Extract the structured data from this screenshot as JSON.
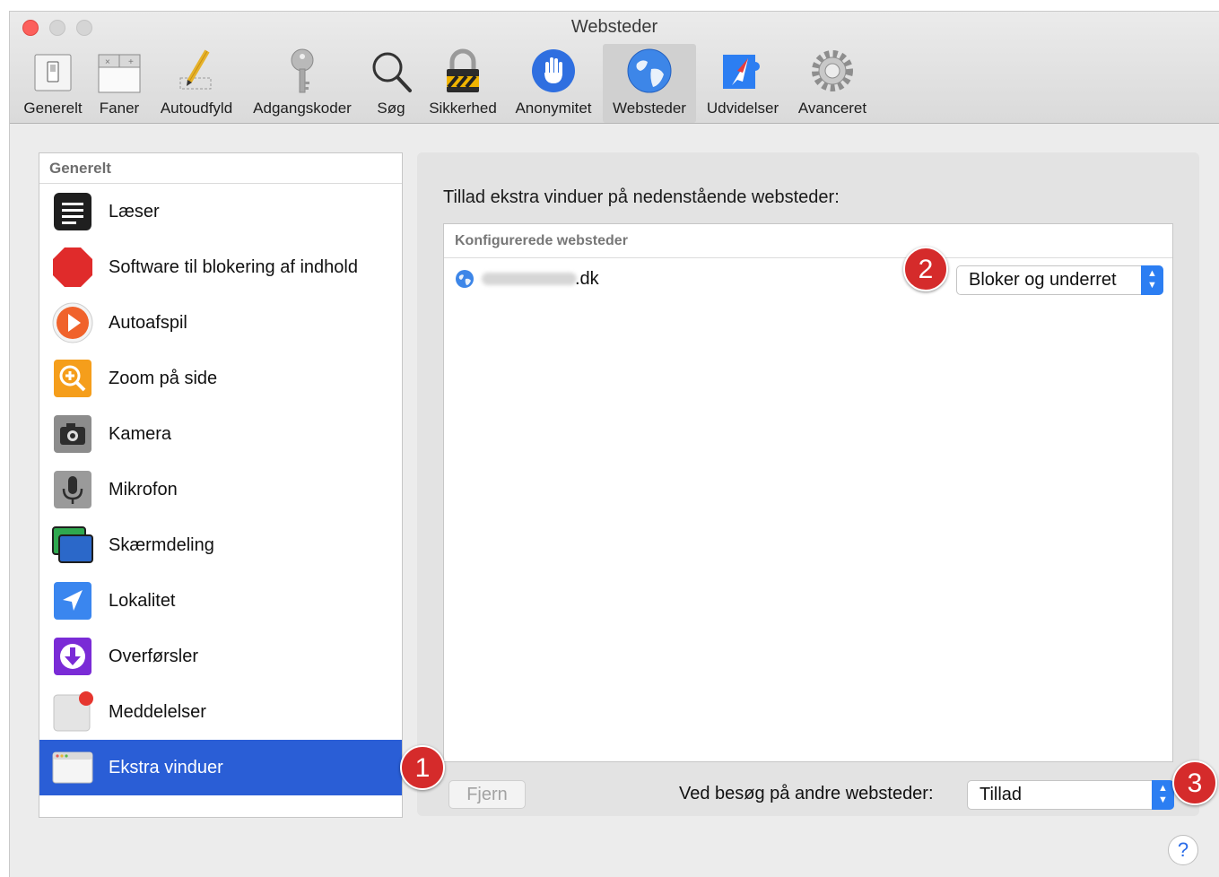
{
  "window": {
    "title": "Websteder"
  },
  "toolbar": {
    "items": [
      {
        "label": "Generelt",
        "icon": "general-switch-icon"
      },
      {
        "label": "Faner",
        "icon": "tabs-icon"
      },
      {
        "label": "Autoudfyld",
        "icon": "pencil-icon"
      },
      {
        "label": "Adgangskoder",
        "icon": "key-icon"
      },
      {
        "label": "Søg",
        "icon": "magnifier-icon"
      },
      {
        "label": "Sikkerhed",
        "icon": "lock-icon"
      },
      {
        "label": "Anonymitet",
        "icon": "hand-icon"
      },
      {
        "label": "Websteder",
        "icon": "globe-icon"
      },
      {
        "label": "Udvidelser",
        "icon": "puzzle-compass-icon"
      },
      {
        "label": "Avanceret",
        "icon": "gear-icon"
      }
    ],
    "active": "Websteder"
  },
  "sidebar": {
    "header": "Generelt",
    "items": [
      {
        "label": "Læser",
        "icon": "reader-icon"
      },
      {
        "label": "Software til blokering af indhold",
        "icon": "stop-sign-icon"
      },
      {
        "label": "Autoafspil",
        "icon": "play-icon"
      },
      {
        "label": "Zoom på side",
        "icon": "zoom-icon"
      },
      {
        "label": "Kamera",
        "icon": "camera-icon"
      },
      {
        "label": "Mikrofon",
        "icon": "microphone-icon"
      },
      {
        "label": "Skærmdeling",
        "icon": "screen-sharing-icon"
      },
      {
        "label": "Lokalitet",
        "icon": "location-arrow-icon"
      },
      {
        "label": "Overførsler",
        "icon": "download-icon"
      },
      {
        "label": "Meddelelser",
        "icon": "notifications-icon"
      },
      {
        "label": "Ekstra vinduer",
        "icon": "popup-windows-icon"
      }
    ],
    "selected": "Ekstra vinduer"
  },
  "main": {
    "title": "Tillad ekstra vinduer på nedenstående websteder:",
    "table_header": "Konfigurerede websteder",
    "rows": [
      {
        "site_suffix": ".dk",
        "setting": "Bloker og underret"
      }
    ],
    "remove_button": "Fjern",
    "other_sites_label": "Ved besøg på andre websteder:",
    "other_sites_value": "Tillad"
  },
  "annotations": {
    "badge1": "1",
    "badge2": "2",
    "badge3": "3"
  },
  "help": "?",
  "colors": {
    "selection": "#2a5ed6",
    "popup_arrow": "#2c7ef2",
    "badge": "#d52b2b"
  }
}
